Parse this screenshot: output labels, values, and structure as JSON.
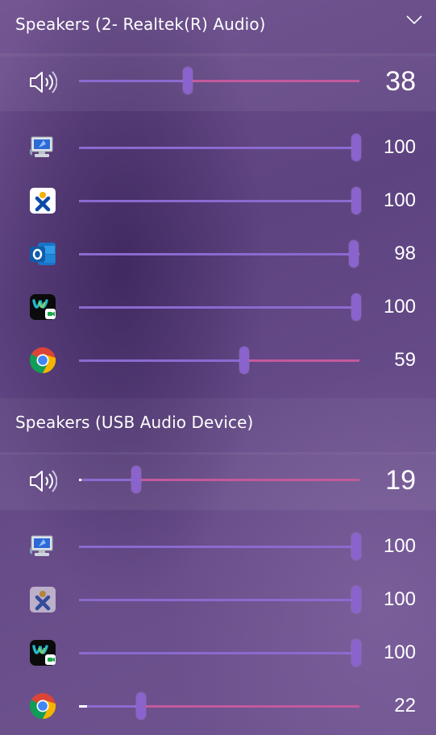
{
  "devices": [
    {
      "name": "Speakers (2- Realtek(R) Audio)",
      "master": {
        "icon": "speaker-icon",
        "volume": 38
      },
      "apps": [
        {
          "icon": "system-sounds-icon",
          "volume": 100,
          "display": "100"
        },
        {
          "icon": "nextcloud-icon",
          "volume": 100,
          "display": "100"
        },
        {
          "icon": "outlook-icon",
          "volume": 98,
          "display": "98"
        },
        {
          "icon": "webex-icon",
          "volume": 100,
          "display": "100"
        },
        {
          "icon": "chrome-icon",
          "volume": 59,
          "display": "59"
        }
      ]
    },
    {
      "name": "Speakers (USB Audio Device)",
      "master": {
        "icon": "speaker-icon",
        "volume": 19
      },
      "apps": [
        {
          "icon": "system-sounds-icon",
          "volume": 100,
          "display": "100"
        },
        {
          "icon": "nextcloud-icon",
          "volume": 100,
          "display": "100"
        },
        {
          "icon": "webex-icon",
          "volume": 100,
          "display": "100"
        },
        {
          "icon": "chrome-icon",
          "volume": 22,
          "display": "22"
        }
      ]
    }
  ],
  "d0_master_display": "38",
  "d1_master_display": "19",
  "colors": {
    "track_left": "#8b6ad0",
    "track_right": "#c25a9c",
    "thumb": "#8a63cc"
  }
}
